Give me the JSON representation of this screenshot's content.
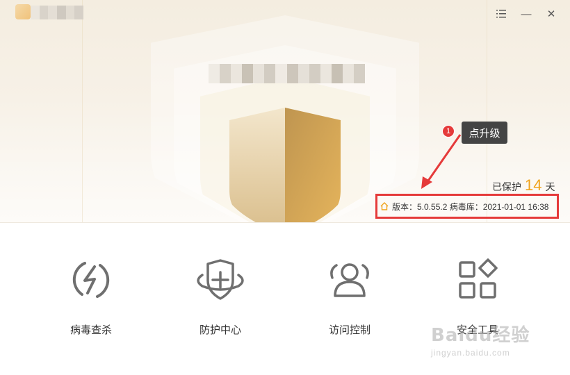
{
  "window": {
    "menu_icon": "list-menu-icon",
    "minimize_label": "—",
    "close_label": "✕"
  },
  "status": {
    "protected_prefix": "已保护",
    "protected_days": "14",
    "protected_suffix": "天"
  },
  "version": {
    "text": "版本：5.0.55.2   病毒库：2021-01-01 16:38"
  },
  "annotation": {
    "badge": "1",
    "tip": "点升级",
    "color": "#e53a3a"
  },
  "features": [
    {
      "label": "病毒查杀",
      "icon": "lightning-circle-icon"
    },
    {
      "label": "防护中心",
      "icon": "shield-plus-icon"
    },
    {
      "label": "访问控制",
      "icon": "users-icon"
    },
    {
      "label": "安全工具",
      "icon": "grid-diamond-icon"
    }
  ],
  "watermark": {
    "main": "Baidu经验",
    "sub": "jingyan.baidu.com"
  },
  "colors": {
    "accent": "#f0a31c",
    "shield_light": "#e8d2a8",
    "shield_dark": "#c59b55"
  }
}
